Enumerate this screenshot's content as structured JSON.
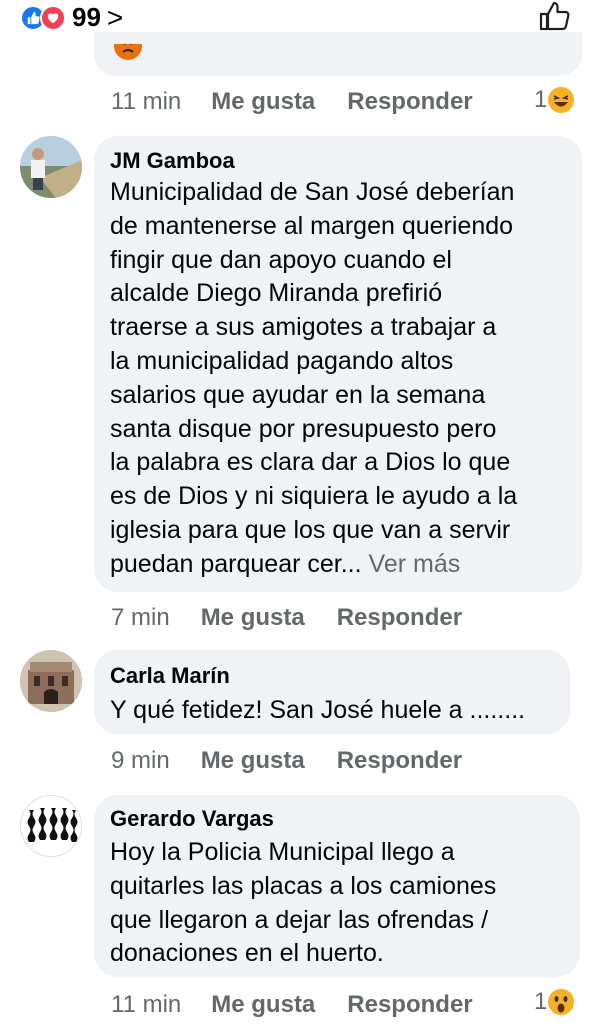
{
  "header": {
    "reaction_count": "99",
    "chevron": ">",
    "icons": [
      "like-reaction-icon",
      "love-reaction-icon",
      "thumbs-up-outline-icon"
    ]
  },
  "previous_comment": {
    "time": "11 min",
    "like_label": "Me gusta",
    "reply_label": "Responder",
    "reaction_count": "1",
    "reaction_icon": "laughing-emoji-icon"
  },
  "comments": [
    {
      "author": "JM Gamboa",
      "lines": [
        "Municipalidad de San José deberían",
        "de mantenerse al margen queriendo",
        "fingir que dan apoyo cuando el",
        "alcalde Diego Miranda prefirió",
        "traerse a sus amigotes a trabajar a",
        "la municipalidad  pagando altos",
        "salarios que ayudar en la semana",
        "santa disque por presupuesto pero",
        "la palabra es clara dar a Dios lo que",
        "es de Dios y ni siquiera le ayudo a la",
        "iglesia para que los que van a servir",
        "puedan parquear cer..."
      ],
      "see_more": "Ver más",
      "time": "7 min",
      "like_label": "Me gusta",
      "reply_label": "Responder"
    },
    {
      "author": "Carla Marín",
      "lines": [
        "Y qué fetidez! San José huele a ........"
      ],
      "time": "9 min",
      "like_label": "Me gusta",
      "reply_label": "Responder"
    },
    {
      "author": "Gerardo Vargas",
      "lines": [
        "Hoy la Policia Municipal llego a",
        "quitarles las placas a los camiones",
        "que llegaron a dejar las ofrendas /",
        "donaciones en el huerto."
      ],
      "time": "11 min",
      "like_label": "Me gusta",
      "reply_label": "Responder",
      "reaction_count": "1",
      "reaction_icon": "surprised-emoji-icon"
    }
  ],
  "colors": {
    "bubble": "#f0f2f5",
    "meta_text": "#65676b",
    "like_blue": "#1877f2",
    "love_red": "#f33e58",
    "emoji_yellow": "#f7b125"
  }
}
